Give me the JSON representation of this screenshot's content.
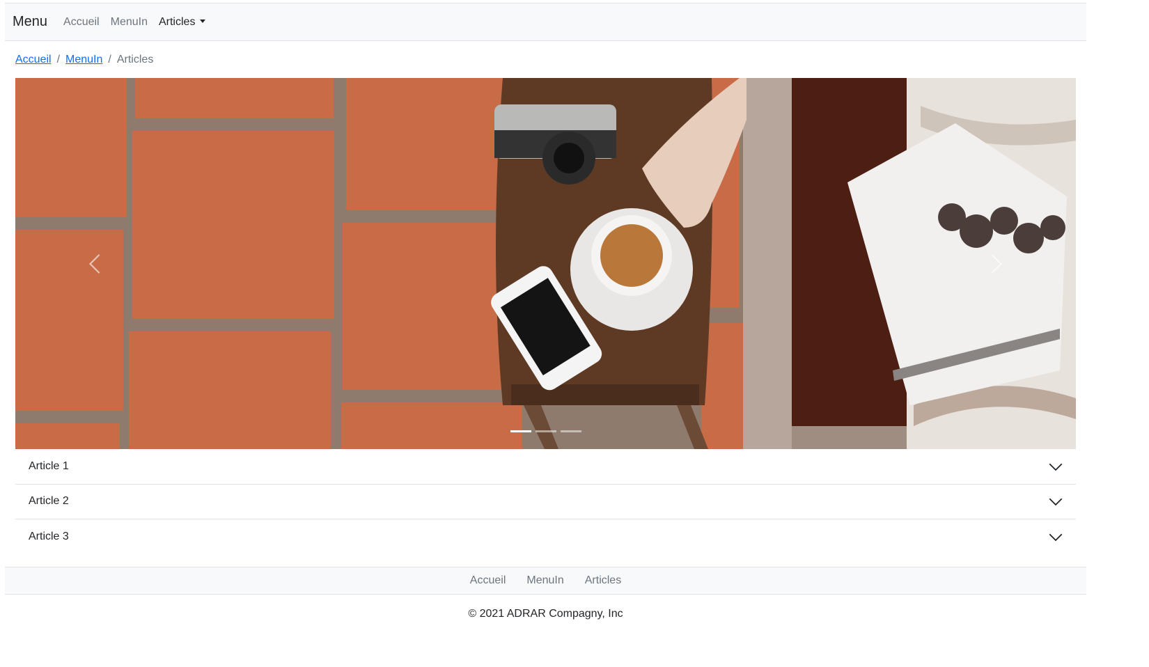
{
  "navbar": {
    "brand": "Menu",
    "links": [
      "Accueil",
      "MenuIn",
      "Articles"
    ]
  },
  "breadcrumb": {
    "items": [
      "Accueil",
      "MenuIn"
    ],
    "current": "Articles",
    "separator": "/"
  },
  "carousel": {
    "icons": {
      "prev": "chevron-left-icon",
      "next": "chevron-right-icon"
    },
    "slide_count": 3,
    "active_slide": 1
  },
  "accordion": {
    "items": [
      "Article 1",
      "Article 2",
      "Article 3"
    ]
  },
  "footer": {
    "links": [
      "Accueil",
      "MenuIn",
      "Articles"
    ],
    "copyright": "© 2021 ADRAR Compagny, Inc"
  },
  "colors": {
    "navbar_bg": "#f8f9fa",
    "link_blue": "#0d6efd",
    "muted": "#6c757d",
    "tile": "#c86b47"
  }
}
